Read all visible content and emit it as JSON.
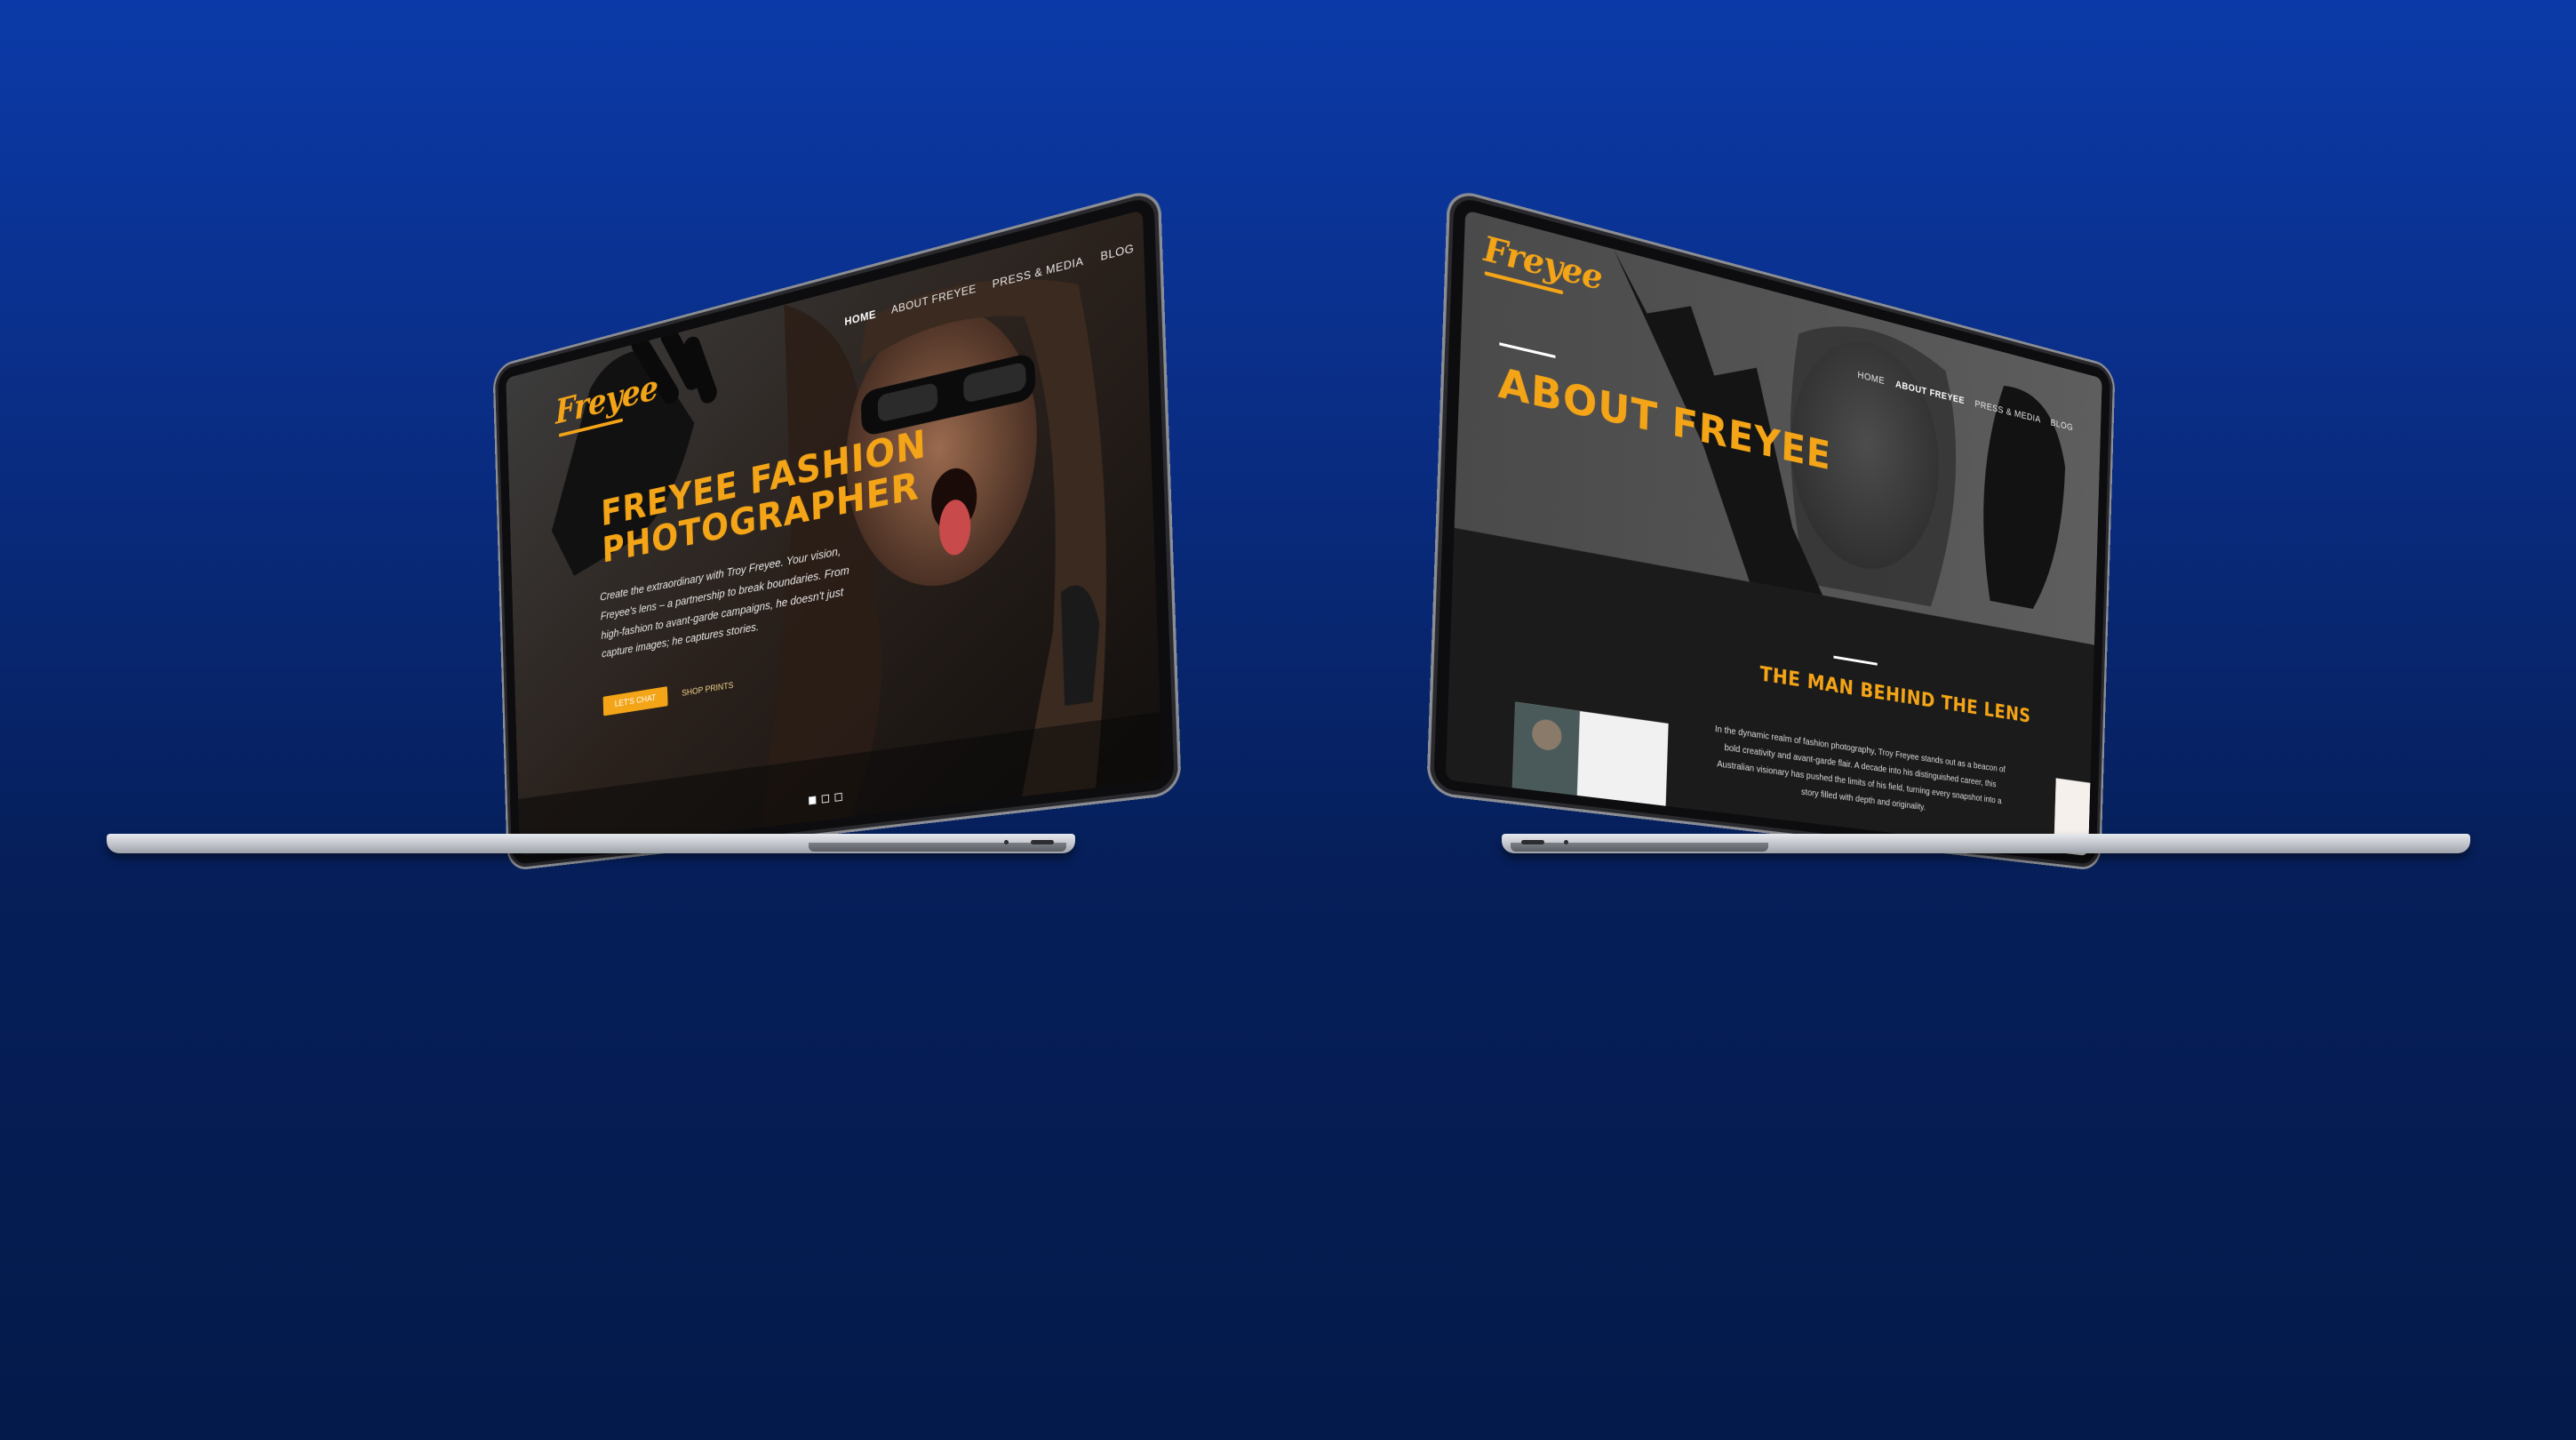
{
  "left_site": {
    "logo": "Freyee",
    "nav": [
      "HOME",
      "ABOUT FREYEE",
      "PRESS & MEDIA",
      "BLOG"
    ],
    "hero_title_line1": "FREYEE FASHION",
    "hero_title_line2": "PHOTOGRAPHER",
    "hero_body": "Create the extraordinary with Troy Freyee. Your vision, Freyee's lens – a partnership to break boundaries. From high-fashion to avant-garde campaigns, he doesn't just capture images; he captures stories.",
    "primary_button": "LET'S CHAT",
    "secondary_button": "SHOP PRINTS",
    "carousel_count": 3,
    "carousel_active": 1
  },
  "right_site": {
    "logo": "Freyee",
    "nav": [
      "HOME",
      "ABOUT FREYEE",
      "PRESS & MEDIA",
      "BLOG"
    ],
    "page_title": "ABOUT FREYEE",
    "section_title": "THE MAN BEHIND THE LENS",
    "section_body": "In the dynamic realm of fashion photography, Troy Freyee stands out as a beacon of bold creativity and avant-garde flair. A decade into his distinguished career, this Australian visionary has pushed the limits of his field, turning every snapshot into a story filled with depth and originality."
  },
  "colors": {
    "accent": "#f4a417",
    "background_top": "#0b3aa8",
    "background_bottom": "#041a4a"
  }
}
